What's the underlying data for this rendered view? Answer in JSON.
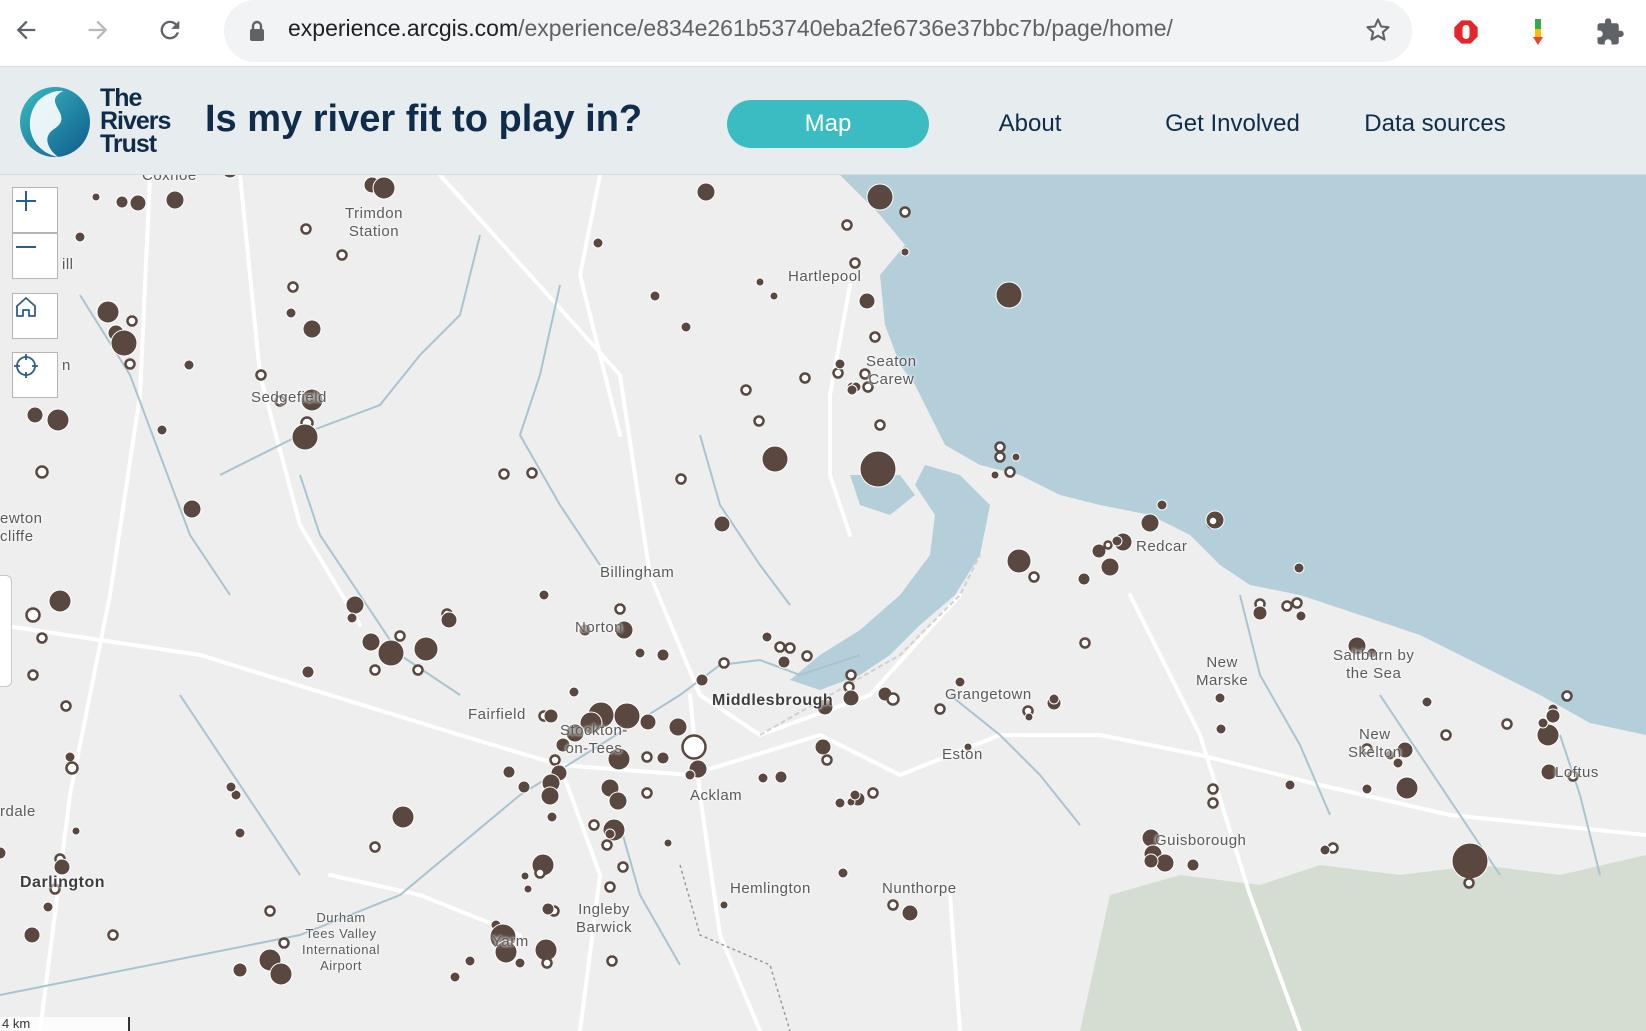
{
  "browser": {
    "url_host": "experience.arcgis.com",
    "url_path": "/experience/e834e261b53740eba2fe6736e37bbc7b/page/home/",
    "icons": [
      "back-arrow-icon",
      "forward-arrow-icon",
      "reload-icon",
      "lock-icon",
      "star-icon",
      "adblock-icon",
      "extension-icon",
      "puzzle-icon"
    ]
  },
  "header": {
    "logo_text_line1": "The",
    "logo_text_line2": "Rivers",
    "logo_text_line3": "Trust",
    "title": "Is my river fit to play in?",
    "nav": [
      {
        "label": "Map",
        "active": true
      },
      {
        "label": "About",
        "active": false
      },
      {
        "label": "Get Involved",
        "active": false
      },
      {
        "label": "Data sources",
        "active": false
      }
    ],
    "accent_color": "#3bbcc2",
    "title_color": "#0f2c4b"
  },
  "map": {
    "colors": {
      "sea": "#b5cfda",
      "land": "#eeeeee",
      "river": "#a8c4d0",
      "road": "#ffffff",
      "marker": "#5a4840",
      "green": "#d5ddd3"
    },
    "tools": [
      {
        "name": "zoom-in-button",
        "icon": "plus-icon"
      },
      {
        "name": "zoom-out-button",
        "icon": "minus-icon"
      },
      {
        "name": "home-button",
        "icon": "home-icon"
      },
      {
        "name": "locate-button",
        "icon": "crosshair-icon"
      }
    ],
    "places": {
      "coxhoe": "Coxhoe",
      "trimdon": "Trimdon",
      "station": "Station",
      "hartlepool": "Hartlepool",
      "seaton": "Seaton",
      "carew": "Carew",
      "sedgefield": "Sedgefield",
      "ill": "ill",
      "on": "n",
      "newton": "ewton",
      "aycliffe": "cliffe",
      "billingham": "Billingham",
      "norton": "Norton",
      "redcar": "Redcar",
      "fairfield": "Fairfield",
      "stockton1": "Stockton-",
      "stockton2": "on-Tees",
      "middlesbrough": "Middlesbrough",
      "grangetown": "Grangetown",
      "eston": "Eston",
      "new_marske1": "New",
      "new_marske2": "Marske",
      "saltburn1": "Saltburn by",
      "saltburn2": "the Sea",
      "new_skelton1": "New",
      "new_skelton2": "Skelton",
      "loftus": "Loftus",
      "acklam": "Acklam",
      "guisborough": "Guisborough",
      "dale": "rdale",
      "darlington": "Darlington",
      "hemlington": "Hemlington",
      "nunthorpe": "Nunthorpe",
      "durham1": "Durham",
      "durham2": "Tees Valley",
      "durham3": "International",
      "durham4": "Airport",
      "ingleby1": "Ingleby",
      "ingleby2": "Barwick",
      "yarm": "Yarm"
    },
    "scale_label": "4 km"
  }
}
